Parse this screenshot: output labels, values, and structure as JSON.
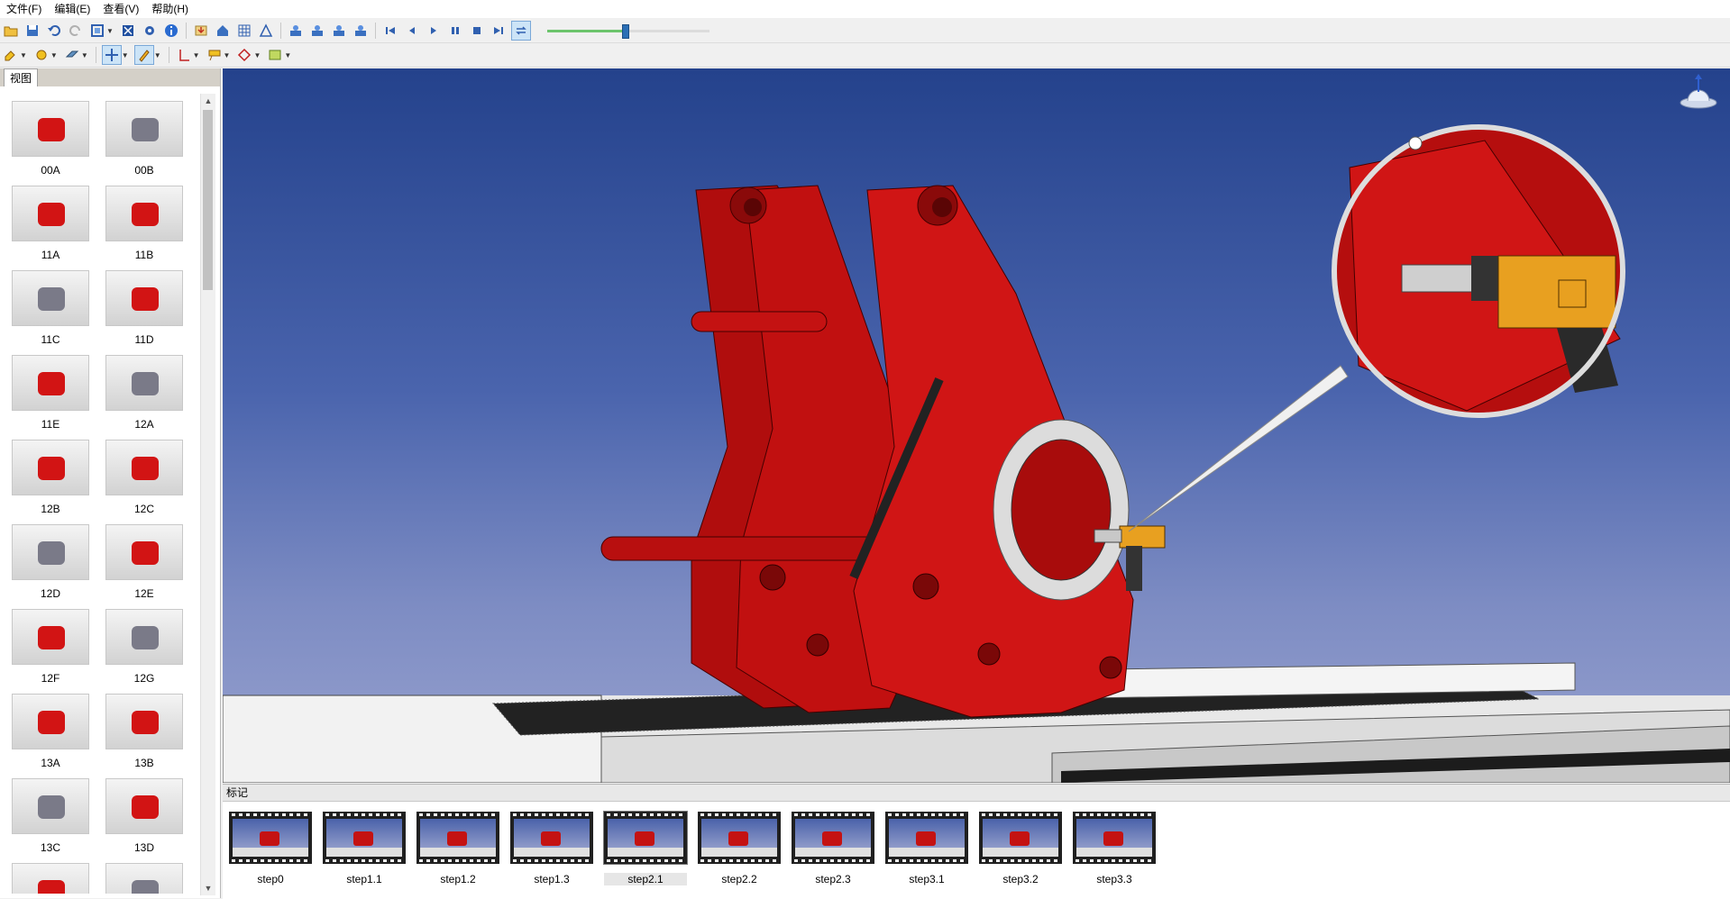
{
  "menu": [
    "文件(F)",
    "编辑(E)",
    "查看(V)",
    "帮助(H)"
  ],
  "animation": {
    "progress": 0.48
  },
  "left_panel": {
    "tab_label": "视图",
    "thumbnails": [
      "00A",
      "00B",
      "11A",
      "11B",
      "11C",
      "11D",
      "11E",
      "12A",
      "12B",
      "12C",
      "12D",
      "12E",
      "12F",
      "12G",
      "13A",
      "13B",
      "13C",
      "13D",
      "",
      ""
    ]
  },
  "marks_panel": {
    "title": "标记",
    "steps": [
      "step0",
      "step1.1",
      "step1.2",
      "step1.3",
      "step2.1",
      "step2.2",
      "step2.3",
      "step3.1",
      "step3.2",
      "step3.3"
    ],
    "active_step": "step2.1"
  },
  "colors": {
    "model_red": "#cc1010",
    "tool_orange": "#e8a020",
    "sky_top": "#24428c",
    "sky_bottom": "#98a2cf"
  }
}
